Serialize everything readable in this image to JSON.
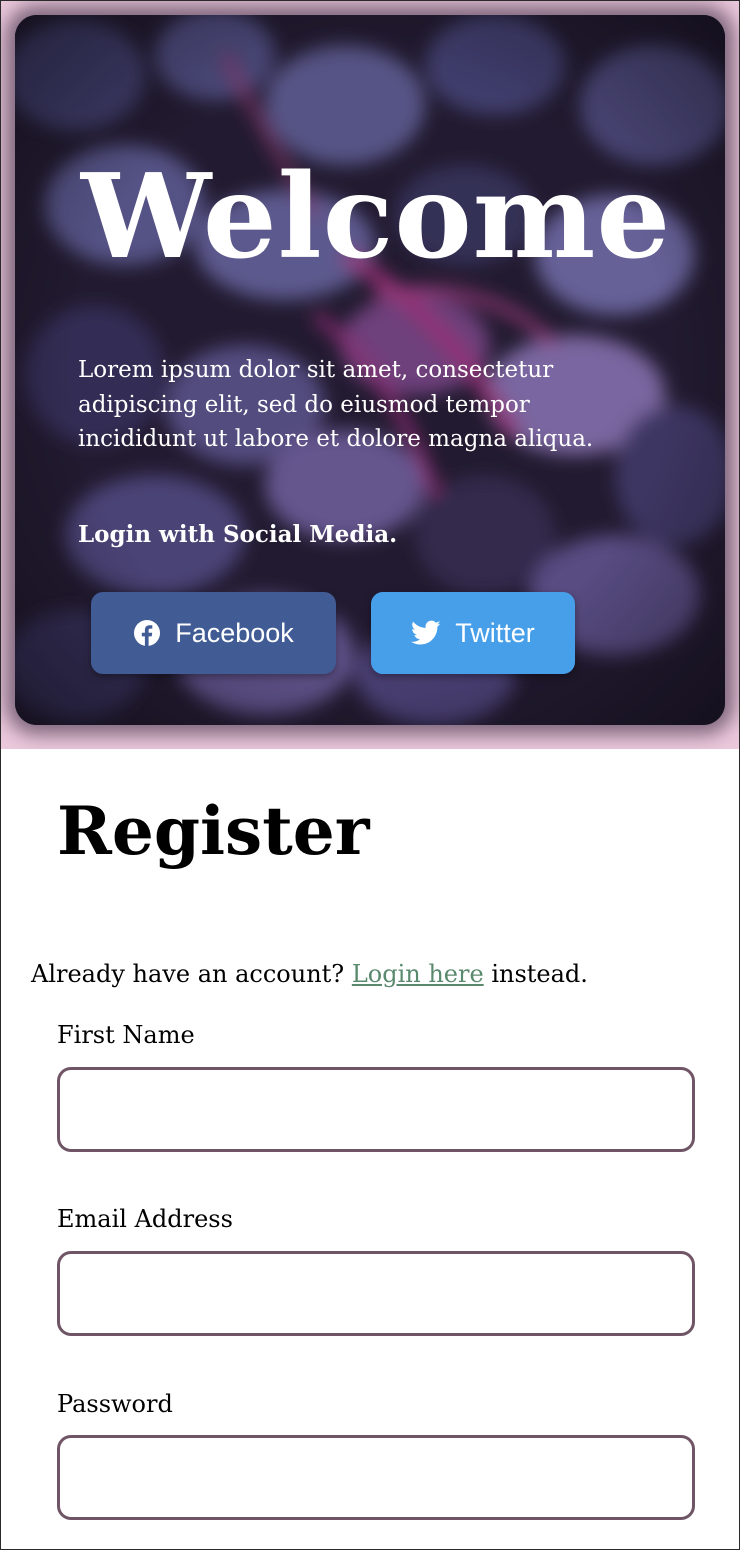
{
  "hero": {
    "title": "Welcome",
    "description": "Lorem ipsum dolor sit amet, consectetur adipiscing elit, sed do eiusmod tempor incididunt ut labore et dolore magna aliqua.",
    "social_label": "Login with Social Media.",
    "background_color": "#ecc8dc",
    "buttons": [
      {
        "label": "Facebook",
        "icon": "facebook-icon",
        "color": "#415b95"
      },
      {
        "label": "Twitter",
        "icon": "twitter-icon",
        "color": "#479fea"
      }
    ]
  },
  "register": {
    "title": "Register",
    "login_prompt": {
      "before": "Already have an account?",
      "link_text": "Login here",
      "after": "instead.",
      "link_color": "#5a8a6e"
    },
    "fields": [
      {
        "label": "First Name",
        "value": ""
      },
      {
        "label": "Email Address",
        "value": ""
      },
      {
        "label": "Password",
        "value": ""
      }
    ],
    "input_border_color": "#6f5566"
  }
}
